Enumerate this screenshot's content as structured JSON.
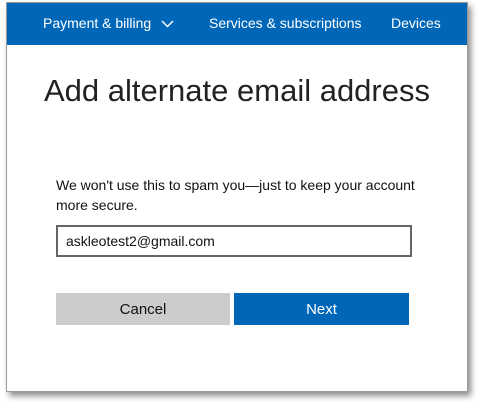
{
  "nav": {
    "items": [
      {
        "label": "Payment & billing",
        "has_dropdown": true
      },
      {
        "label": "Services & subscriptions"
      },
      {
        "label": "Devices"
      }
    ],
    "background": "#0067b8"
  },
  "page": {
    "title": "Add alternate email address",
    "description": "We won't use this to spam you—just to keep your account more secure."
  },
  "form": {
    "email_value": "askleotest2@gmail.com"
  },
  "buttons": {
    "cancel_label": "Cancel",
    "next_label": "Next"
  },
  "colors": {
    "accent": "#0067b8",
    "cancel_bg": "#cccccc"
  },
  "icons": {
    "dropdown": "chevron-down-icon"
  }
}
